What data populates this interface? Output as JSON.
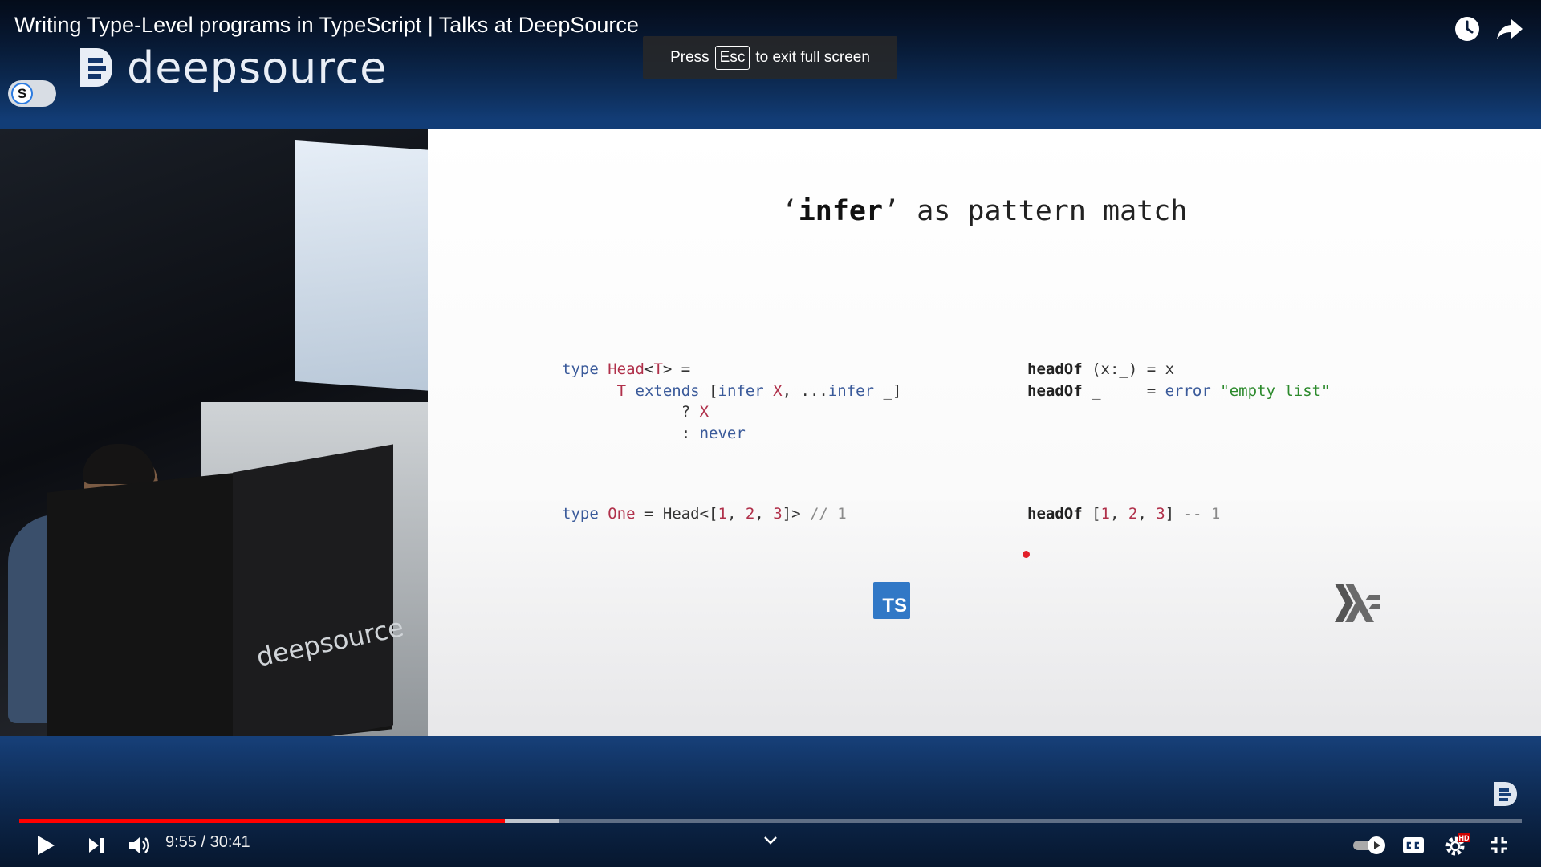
{
  "window": {
    "video_title": "Writing Type-Level programs in TypeScript | Talks at DeepSource"
  },
  "overlay": {
    "brand_name": "deepsource",
    "toggle_letter": "S",
    "fullscreen_toast": {
      "before": "Press",
      "key": "Esc",
      "after": "to exit full screen"
    }
  },
  "camera": {
    "podium_logo": "deepsource"
  },
  "slide": {
    "title_quote_open": "‘",
    "title_keyword": "infer",
    "title_quote_close": "’",
    "title_rest": " as pattern match",
    "ts_badge": "TS"
  },
  "player": {
    "current_time": "9:55",
    "duration": "30:41",
    "time_separator": " / ",
    "progress_fraction": 0.3233,
    "buffered_fraction": 0.3592,
    "accent_color": "#ff0000",
    "icons": [
      "watch-later-icon",
      "share-icon",
      "play-icon",
      "next-icon",
      "volume-icon",
      "autoplay-toggle",
      "captions-icon",
      "settings-icon",
      "exit-fullscreen-icon",
      "chevron-down-icon"
    ],
    "settings_badge": "HD"
  }
}
